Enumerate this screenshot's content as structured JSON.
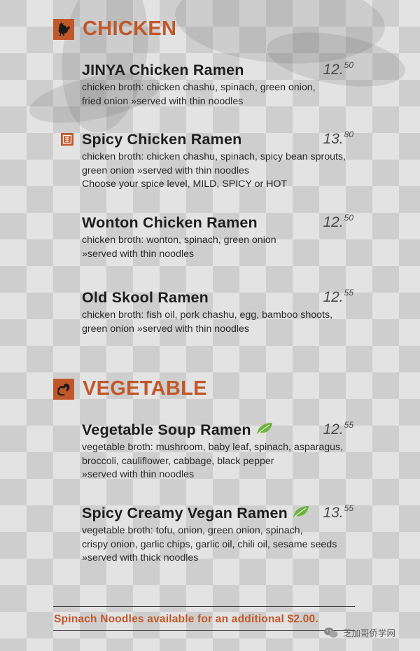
{
  "sections": [
    {
      "title": "CHICKEN",
      "icon": "chicken-icon",
      "items": [
        {
          "name": "JINYA Chicken Ramen",
          "price_main": "12.",
          "price_cents": "50",
          "lines": [
            "chicken broth: chicken chashu, spinach, green onion,",
            "fried onion »served with thin noodles"
          ]
        },
        {
          "name": "Spicy Chicken Ramen",
          "price_main": "13.",
          "price_cents": "80",
          "spicy": true,
          "lines": [
            "chicken broth: chicken chashu, spinach, spicy bean sprouts,",
            "green onion »served with thin noodles",
            "Choose your spice level, MILD, SPICY or HOT"
          ]
        },
        {
          "name": "Wonton Chicken Ramen",
          "price_main": "12.",
          "price_cents": "50",
          "lines": [
            "chicken broth: wonton, spinach, green onion",
            "»served with thin noodles"
          ]
        },
        {
          "name": "Old Skool Ramen",
          "price_main": "12.",
          "price_cents": "55",
          "lines": [
            "chicken broth: fish oil, pork chashu, egg, bamboo shoots,",
            "green onion »served with thin noodles"
          ]
        }
      ]
    },
    {
      "title": "VEGETABLE",
      "icon": "squirrel-icon",
      "items": [
        {
          "name": "Vegetable Soup Ramen",
          "price_main": "12.",
          "price_cents": "55",
          "vegan": true,
          "lines": [
            "vegetable broth: mushroom, baby leaf, spinach, asparagus,",
            "broccoli, cauliflower, cabbage, black pepper",
            "»served with thin noodles"
          ]
        },
        {
          "name": "Spicy Creamy Vegan Ramen",
          "price_main": "13.",
          "price_cents": "55",
          "vegan": true,
          "lines": [
            "vegetable broth: tofu, onion, green onion, spinach,",
            "crispy onion, garlic chips, garlic oil, chili oil, sesame seeds",
            "»served with thick noodles"
          ]
        }
      ]
    }
  ],
  "footnote": "Spinach Noodles available for an additional $2.00.",
  "watermark": "芝加哥侨学网",
  "colors": {
    "accent": "#c1582a",
    "leaf": "#6db33f"
  }
}
